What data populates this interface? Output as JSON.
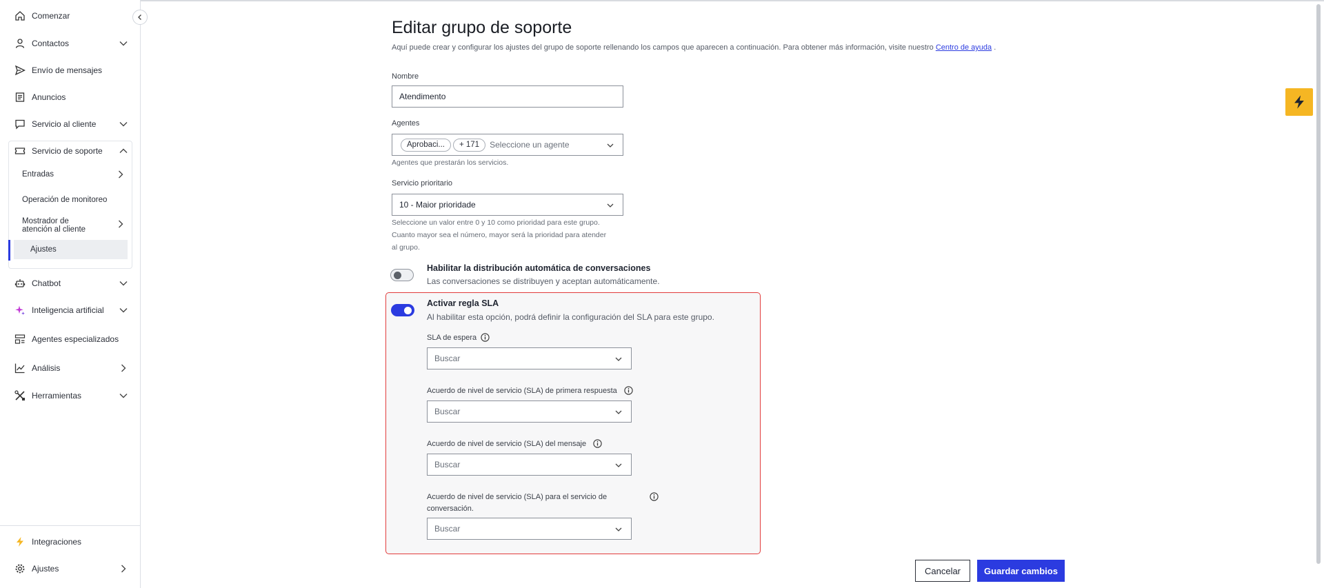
{
  "sidebar": {
    "items": [
      {
        "label": "Comenzar",
        "icon": "home-icon"
      },
      {
        "label": "Contactos",
        "icon": "person-icon"
      },
      {
        "label": "Envío de mensajes",
        "icon": "send-icon"
      },
      {
        "label": "Anuncios",
        "icon": "document-icon"
      },
      {
        "label": "Servicio al cliente",
        "icon": "chat-icon"
      },
      {
        "label": "Servicio de soporte",
        "icon": "ticket-icon"
      },
      {
        "label": "Chatbot",
        "icon": "bot-icon"
      },
      {
        "label": "Inteligencia artificial",
        "icon": "sparkle-icon"
      },
      {
        "label": "Agentes especializados",
        "icon": "agents-icon"
      },
      {
        "label": "Análisis",
        "icon": "chart-icon"
      },
      {
        "label": "Herramientas",
        "icon": "tools-icon"
      },
      {
        "label": "Integraciones",
        "icon": "bolt-icon"
      },
      {
        "label": "Ajustes",
        "icon": "gear-icon"
      }
    ],
    "sub_items": [
      {
        "label": "Entradas"
      },
      {
        "label": "Operación de monitoreo"
      },
      {
        "label": "Mostrador de atención al cliente"
      },
      {
        "label": "Ajustes"
      }
    ]
  },
  "page": {
    "title": "Editar grupo de soporte",
    "description": "Aquí puede crear y configurar los ajustes del grupo de soporte rellenando los campos que aparecen a continuación. Para obtener más información, visite nuestro",
    "help_link": "Centro de ayuda",
    "help_suffix": "."
  },
  "form": {
    "name_label": "Nombre",
    "name_value": "Atendimento",
    "agents_label": "Agentes",
    "agent_chip": "Aprobaci...",
    "agent_more": "+ 171",
    "agents_placeholder": "Seleccione un agente",
    "agents_hint": "Agentes que prestarán los servicios.",
    "priority_label": "Servicio prioritario",
    "priority_value": "10 - Maior prioridade",
    "priority_hint_1": "Seleccione un valor entre 0 y 10 como prioridad para este grupo.",
    "priority_hint_2": "Cuanto mayor sea el número, mayor será la prioridad para atender",
    "priority_hint_3": "al grupo.",
    "auto_dist_title": "Habilitar la distribución automática de conversaciones",
    "auto_dist_desc": "Las conversaciones se distribuyen y aceptan automáticamente.",
    "auto_dist_enabled": false,
    "sla_title": "Activar regla SLA",
    "sla_desc": "Al habilitar esta opción, podrá definir la configuración del SLA para este grupo.",
    "sla_enabled": true,
    "sla_wait_label": "SLA de espera",
    "sla_first_label": "Acuerdo de nivel de servicio (SLA) de primera respuesta",
    "sla_message_label": "Acuerdo de nivel de servicio (SLA) del mensaje",
    "sla_conv_label_1": "Acuerdo de nivel de servicio (SLA) para el servicio de",
    "sla_conv_label_2": "conversación.",
    "search_placeholder": "Buscar"
  },
  "actions": {
    "cancel": "Cancelar",
    "save": "Guardar cambios"
  },
  "colors": {
    "accent": "#2b3be0",
    "highlight_border": "#e23b3b",
    "bolt": "#f5b623"
  }
}
